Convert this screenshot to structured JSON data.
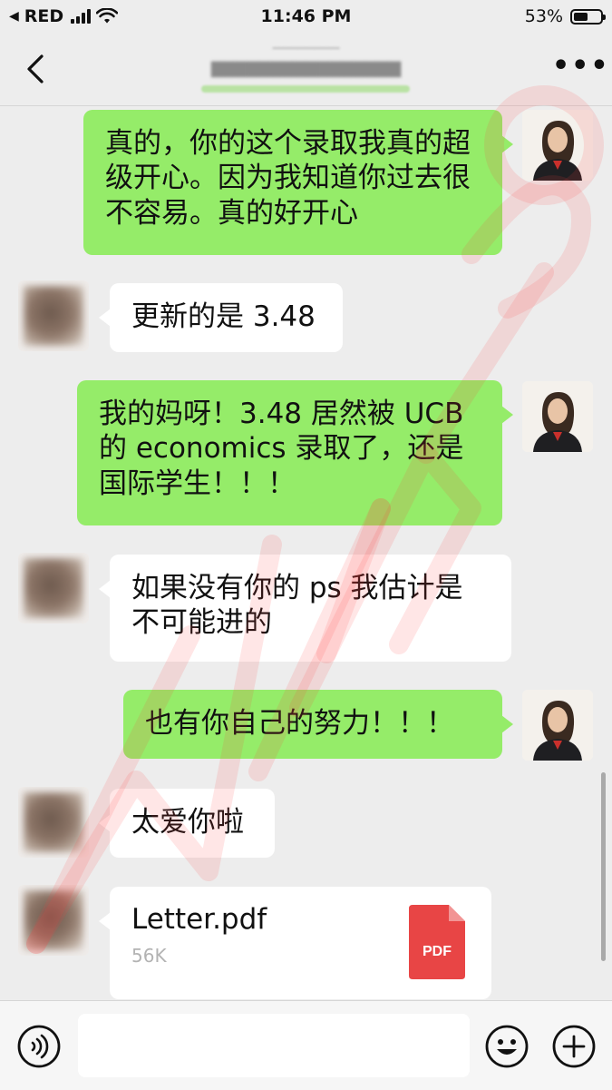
{
  "status_bar": {
    "carrier": "RED",
    "time": "11:46 PM",
    "battery_percent": "53%",
    "battery_level": 0.53,
    "signal_icon": "signal-bars-icon",
    "wifi_icon": "wifi-icon"
  },
  "nav": {
    "back_icon": "chevron-left-icon",
    "more_icon": "ellipsis-icon",
    "more_label": "•••"
  },
  "colors": {
    "sent_bubble": "#95ec69",
    "received_bubble": "#ffffff",
    "background": "#ededed",
    "pdf_red": "#e84545",
    "watermark": "#ff3b3b"
  },
  "messages": [
    {
      "from": "me",
      "text": "真的，你的这个录取我真的超级开心。因为我知道你过去很不容易。真的好开心"
    },
    {
      "from": "other",
      "text": "更新的是 3.48"
    },
    {
      "from": "me",
      "text": "我的妈呀！3.48 居然被 UCB 的 economics 录取了，还是国际学生！！！"
    },
    {
      "from": "other",
      "text": "如果没有你的 ps 我估计是不可能进的"
    },
    {
      "from": "me",
      "text": "也有你自己的努力！！！"
    },
    {
      "from": "other",
      "text": "太爱你啦"
    },
    {
      "from": "other",
      "type": "file",
      "file_name": "Letter.pdf",
      "file_size": "56K",
      "file_icon_label": "PDF"
    }
  ],
  "input_bar": {
    "voice_icon": "voice-icon",
    "emoji_icon": "emoji-icon",
    "plus_icon": "plus-circle-icon",
    "text_value": ""
  }
}
